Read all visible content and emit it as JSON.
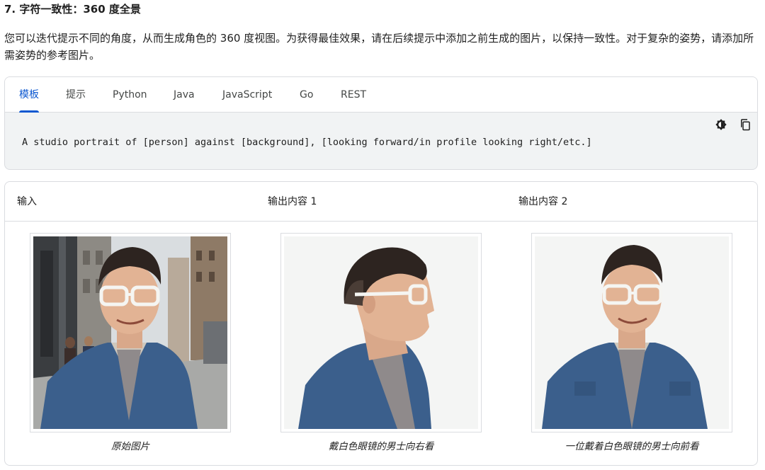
{
  "section": {
    "heading": "7. 字符一致性：360 度全景",
    "intro": "您可以迭代提示不同的角度，从而生成角色的 360 度视图。为获得最佳效果，请在后续提示中添加之前生成的图片，以保持一致性。对于复杂的姿势，请添加所需姿势的参考图片。"
  },
  "code_block": {
    "tabs": [
      {
        "label": "模板",
        "active": true
      },
      {
        "label": "提示",
        "active": false
      },
      {
        "label": "Python",
        "active": false
      },
      {
        "label": "Java",
        "active": false
      },
      {
        "label": "JavaScript",
        "active": false
      },
      {
        "label": "Go",
        "active": false
      },
      {
        "label": "REST",
        "active": false
      }
    ],
    "code": "A studio portrait of [person] against [background], [looking forward/in profile looking right/etc.]",
    "icons": [
      "theme-toggle-icon",
      "copy-icon"
    ]
  },
  "table": {
    "headers": [
      "输入",
      "输出内容 1",
      "输出内容 2"
    ],
    "images": [
      {
        "caption": "原始图片",
        "view": "street-front"
      },
      {
        "caption": "戴白色眼镜的男士向右看",
        "view": "studio-profile"
      },
      {
        "caption": "一位戴着白色眼镜的男士向前看",
        "view": "studio-front"
      }
    ]
  },
  "colors": {
    "accent": "#0b57d0",
    "border": "#dadce0",
    "code_bg": "#f1f3f4",
    "denim": "#3b5f8c"
  }
}
